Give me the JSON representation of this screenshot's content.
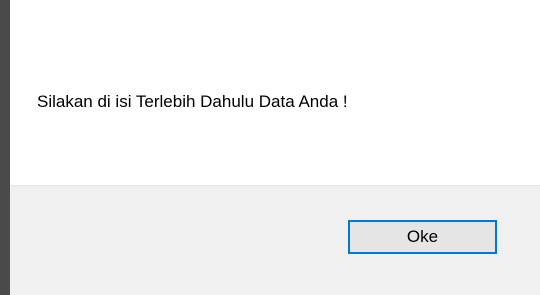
{
  "dialog": {
    "message": "Silakan di isi Terlebih Dahulu Data Anda !",
    "ok_label": "Oke"
  },
  "colors": {
    "accent": "#0078d7",
    "button_area_bg": "#f0f0f0",
    "button_bg": "#e5e5e5",
    "content_bg": "#ffffff"
  }
}
